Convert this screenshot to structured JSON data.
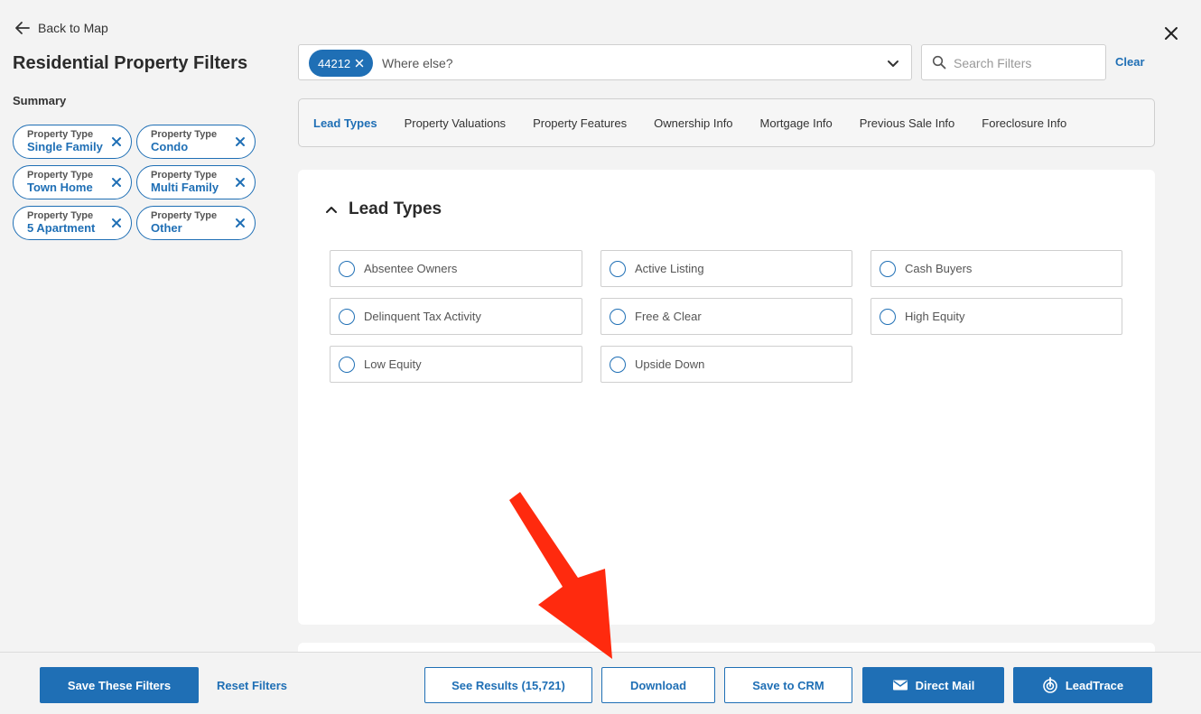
{
  "nav": {
    "back_label": "Back to Map"
  },
  "page": {
    "title": "Residential Property Filters",
    "summary_label": "Summary"
  },
  "summary_chips": [
    {
      "key": "Property Type",
      "value": "Single Family"
    },
    {
      "key": "Property Type",
      "value": "Condo"
    },
    {
      "key": "Property Type",
      "value": "Town Home"
    },
    {
      "key": "Property Type",
      "value": "Multi Family"
    },
    {
      "key": "Property Type",
      "value": "5 Apartment"
    },
    {
      "key": "Property Type",
      "value": "Other"
    }
  ],
  "location": {
    "zip_chip": "44212",
    "placeholder": "Where else?"
  },
  "search": {
    "placeholder": "Search Filters",
    "clear_label": "Clear"
  },
  "tabs": [
    {
      "label": "Lead Types",
      "active": true
    },
    {
      "label": "Property Valuations"
    },
    {
      "label": "Property Features"
    },
    {
      "label": "Ownership Info"
    },
    {
      "label": "Mortgage Info"
    },
    {
      "label": "Previous Sale Info"
    },
    {
      "label": "Foreclosure Info"
    }
  ],
  "section": {
    "title": "Lead Types",
    "options": [
      "Absentee Owners",
      "Active Listing",
      "Cash Buyers",
      "Delinquent Tax Activity",
      "Free & Clear",
      "High Equity",
      "Low Equity",
      "Upside Down"
    ]
  },
  "footer": {
    "save_filters": "Save These Filters",
    "reset_filters": "Reset Filters",
    "see_results": "See Results (15,721)",
    "download": "Download",
    "save_crm": "Save to CRM",
    "direct_mail": "Direct Mail",
    "leadtrace": "LeadTrace"
  },
  "colors": {
    "accent": "#1f6fb5",
    "annotation_arrow": "#ff2a0e"
  }
}
